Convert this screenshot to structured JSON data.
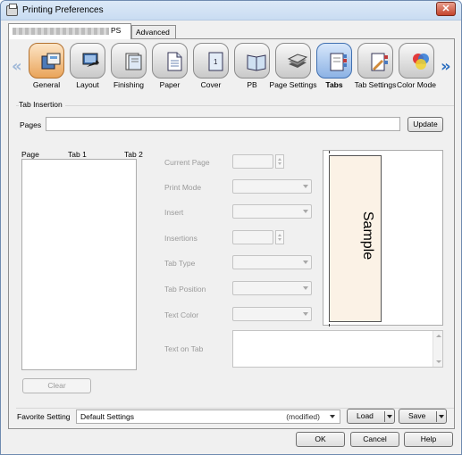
{
  "window": {
    "title": "Printing Preferences",
    "close_label": "✕"
  },
  "tabs": [
    {
      "label": "PS"
    },
    {
      "label": "Advanced"
    }
  ],
  "ribbon": {
    "items": [
      {
        "label": "General",
        "icon": "general-icon"
      },
      {
        "label": "Layout",
        "icon": "layout-icon"
      },
      {
        "label": "Finishing",
        "icon": "finishing-icon"
      },
      {
        "label": "Paper",
        "icon": "paper-icon"
      },
      {
        "label": "Cover",
        "icon": "cover-icon"
      },
      {
        "label": "PB",
        "icon": "pb-icon"
      },
      {
        "label": "Page Settings",
        "icon": "page-settings-icon"
      },
      {
        "label": "Tabs",
        "icon": "tabs-icon"
      },
      {
        "label": "Tab Settings",
        "icon": "tab-settings-icon"
      },
      {
        "label": "Color Mode",
        "icon": "color-mode-icon"
      }
    ],
    "left_arrow": "«",
    "right_arrow": "»"
  },
  "tab_insertion": {
    "group_label": "Tab Insertion",
    "pages_label": "Pages",
    "pages_value": "",
    "update_label": "Update",
    "list_headers": [
      "Page",
      "Tab 1",
      "Tab 2"
    ],
    "clear_label": "Clear"
  },
  "settings": {
    "current_page": "Current Page",
    "print_mode": "Print Mode",
    "insert": "Insert",
    "insertions": "Insertions",
    "tab_type": "Tab Type",
    "tab_position": "Tab Position",
    "text_color": "Text Color",
    "text_on_tab": "Text on Tab"
  },
  "preview": {
    "sample_text": "Sample"
  },
  "footer": {
    "favorite_label": "Favorite Setting",
    "favorite_value": "Default Settings",
    "favorite_state": "(modified)",
    "load_label": "Load",
    "save_label": "Save",
    "ok_label": "OK",
    "cancel_label": "Cancel",
    "help_label": "Help"
  },
  "colors": {
    "selected_tab": "#8cb2e4",
    "general_tab": "#e9a45a",
    "title_bar": "#c9dcf2"
  }
}
